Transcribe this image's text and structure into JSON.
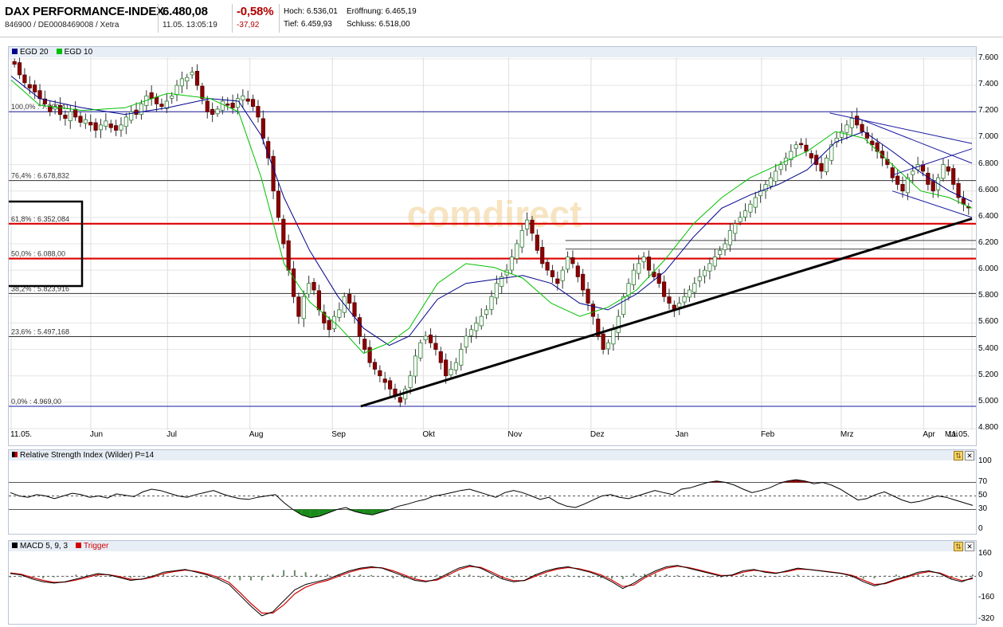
{
  "header": {
    "name": "DAX PERFORMANCE-INDEX",
    "ids": "846900 / DE0008469008 / Xetra",
    "price": "6.480,08",
    "time": "11.05. 13:05:19",
    "change_pct": "-0,58%",
    "change_abs": "-37,92",
    "hoch_label": "Hoch:",
    "hoch": "6.536,01",
    "tief_label": "Tief:",
    "tief": "6.459,93",
    "eroeffnung_label": "Eröffnung:",
    "eroeffnung": "6.465,19",
    "schluss_label": "Schluss:",
    "schluss": "6.518,00"
  },
  "watermark": "comdirect",
  "colors": {
    "candle_up": "#2e7d32",
    "candle_down": "#8b0000",
    "egd20": "#00008b",
    "egd10": "#00c000",
    "fib_support": "#dd0000",
    "trend": "#000000",
    "channel": "#1a1aa0",
    "macd": "#000000",
    "trigger": "#d00000"
  },
  "main_chart": {
    "legend": [
      {
        "label": "EGD 20",
        "color": "#00008b"
      },
      {
        "label": "EGD 10",
        "color": "#00c000"
      }
    ],
    "y_ticks": [
      "7.600",
      "7.400",
      "7.200",
      "7.000",
      "6.800",
      "6.600",
      "6.400",
      "6.200",
      "6.000",
      "5.800",
      "5.600",
      "5.400",
      "5.200",
      "5.000",
      "4.800"
    ],
    "x_labels": [
      "11.05.",
      "Jun",
      "Jul",
      "Aug",
      "Sep",
      "Okt",
      "Nov",
      "Dez",
      "Jan",
      "Feb",
      "Mrz",
      "Apr",
      "Mai",
      "11.05."
    ],
    "fib_levels": [
      {
        "label": "100,0% : 7.200,41",
        "value": 7200.41
      },
      {
        "label": "76,4% : 6.678,832",
        "value": 6678.832
      },
      {
        "label": "61,8% : 6.352,084",
        "value": 6352.084
      },
      {
        "label": "50,0% : 6.088,00",
        "value": 6088.0
      },
      {
        "label": "38,2% : 5.823,916",
        "value": 5823.916
      },
      {
        "label": "23,6% : 5.497,168",
        "value": 5497.168
      },
      {
        "label": "0,0% : 4.969,00",
        "value": 4969.0
      }
    ]
  },
  "chart_data": [
    {
      "type": "candlestick",
      "title": "DAX PERFORMANCE-INDEX",
      "x_range": [
        "11.05.",
        "11.05."
      ],
      "ylim": [
        4800,
        7600
      ],
      "grid": true,
      "legend_position": "top-left",
      "series": [
        {
          "name": "EGD 20",
          "type": "line",
          "points": [
            [
              0,
              7470
            ],
            [
              10,
              7300
            ],
            [
              25,
              7230
            ],
            [
              40,
              7180
            ],
            [
              55,
              7230
            ],
            [
              70,
              7300
            ],
            [
              80,
              7280
            ],
            [
              88,
              7020
            ],
            [
              96,
              6550
            ],
            [
              105,
              6150
            ],
            [
              115,
              5800
            ],
            [
              124,
              5560
            ],
            [
              133,
              5430
            ],
            [
              140,
              5500
            ],
            [
              150,
              5780
            ],
            [
              160,
              5900
            ],
            [
              170,
              5930
            ],
            [
              180,
              5960
            ],
            [
              190,
              5900
            ],
            [
              200,
              5750
            ],
            [
              210,
              5700
            ],
            [
              220,
              5820
            ],
            [
              230,
              5990
            ],
            [
              240,
              6250
            ],
            [
              250,
              6470
            ],
            [
              260,
              6570
            ],
            [
              270,
              6650
            ],
            [
              280,
              6760
            ],
            [
              290,
              6970
            ],
            [
              300,
              7050
            ],
            [
              310,
              6900
            ],
            [
              320,
              6740
            ],
            [
              330,
              6600
            ],
            [
              338,
              6520
            ]
          ]
        },
        {
          "name": "EGD 10",
          "type": "line",
          "points": [
            [
              0,
              7440
            ],
            [
              10,
              7250
            ],
            [
              25,
              7210
            ],
            [
              40,
              7230
            ],
            [
              55,
              7340
            ],
            [
              70,
              7300
            ],
            [
              80,
              7200
            ],
            [
              88,
              6700
            ],
            [
              96,
              6050
            ],
            [
              105,
              5760
            ],
            [
              115,
              5580
            ],
            [
              124,
              5370
            ],
            [
              133,
              5450
            ],
            [
              140,
              5560
            ],
            [
              150,
              5900
            ],
            [
              160,
              6050
            ],
            [
              170,
              6020
            ],
            [
              180,
              5940
            ],
            [
              190,
              5750
            ],
            [
              200,
              5650
            ],
            [
              210,
              5720
            ],
            [
              220,
              5850
            ],
            [
              230,
              6080
            ],
            [
              240,
              6350
            ],
            [
              250,
              6550
            ],
            [
              260,
              6700
            ],
            [
              270,
              6800
            ],
            [
              280,
              6900
            ],
            [
              290,
              7050
            ],
            [
              300,
              7000
            ],
            [
              310,
              6800
            ],
            [
              320,
              6600
            ],
            [
              330,
              6550
            ],
            [
              338,
              6470
            ]
          ]
        },
        {
          "name": "Trend",
          "type": "line",
          "points": [
            [
              123,
              4969
            ],
            [
              338,
              6390
            ]
          ]
        },
        {
          "name": "Channel upper",
          "type": "line",
          "points": [
            [
              288,
              7190
            ],
            [
              338,
              6960
            ]
          ]
        },
        {
          "name": "Channel mid",
          "type": "line",
          "points": [
            [
              298,
              7150
            ],
            [
              338,
              6810
            ]
          ]
        },
        {
          "name": "Channel low",
          "type": "line",
          "points": [
            [
              310,
              6600
            ],
            [
              338,
              6400
            ]
          ]
        },
        {
          "name": "Channel inner",
          "type": "line",
          "points": [
            [
              310,
              6720
            ],
            [
              338,
              6920
            ]
          ]
        }
      ],
      "candles_close": [
        7560,
        7480,
        7420,
        7380,
        7350,
        7300,
        7260,
        7200,
        7240,
        7180,
        7150,
        7200,
        7160,
        7120,
        7140,
        7100,
        7060,
        7100,
        7130,
        7080,
        7060,
        7100,
        7160,
        7200,
        7180,
        7260,
        7320,
        7300,
        7260,
        7240,
        7280,
        7320,
        7400,
        7450,
        7460,
        7500,
        7400,
        7300,
        7200,
        7180,
        7220,
        7280,
        7250,
        7230,
        7300,
        7320,
        7280,
        7240,
        7160,
        7000,
        6850,
        6600,
        6400,
        6200,
        6000,
        5800,
        5650,
        5800,
        5900,
        5850,
        5700,
        5600,
        5550,
        5650,
        5700,
        5800,
        5750,
        5650,
        5500,
        5400,
        5300,
        5250,
        5200,
        5150,
        5100,
        5050,
        5000,
        5100,
        5200,
        5350,
        5450,
        5500,
        5450,
        5400,
        5300,
        5200,
        5250,
        5300,
        5400,
        5500,
        5550,
        5600,
        5650,
        5700,
        5800,
        5900,
        5950,
        6000,
        6100,
        6200,
        6300,
        6380,
        6280,
        6150,
        6050,
        6000,
        5950,
        5900,
        6000,
        6100,
        6050,
        5950,
        5850,
        5750,
        5650,
        5500,
        5400,
        5450,
        5550,
        5650,
        5800,
        5900,
        6000,
        6050,
        6100,
        6000,
        5950,
        5900,
        5800,
        5750,
        5700,
        5750,
        5800,
        5850,
        5900,
        5950,
        6000,
        6050,
        6100,
        6150,
        6200,
        6300,
        6350,
        6400,
        6450,
        6500,
        6550,
        6600,
        6650,
        6700,
        6750,
        6800,
        6850,
        6900,
        6950,
        6950,
        6900,
        6850,
        6800,
        6750,
        6850,
        6950,
        7000,
        7050,
        7100,
        7150,
        7100,
        7050,
        7000,
        6950,
        6900,
        6850,
        6800,
        6700,
        6650,
        6600,
        6700,
        6750,
        6800,
        6750,
        6650,
        6600,
        6700,
        6800,
        6750,
        6650,
        6550,
        6500,
        6480
      ]
    },
    {
      "type": "line",
      "title": "Relative Strength Index (Wilder) P=14",
      "ylim": [
        0,
        100
      ],
      "y_ticks": [
        "100",
        "70",
        "50",
        "30",
        "0"
      ],
      "reference_lines": [
        70,
        50,
        30
      ],
      "series": [
        {
          "name": "RSI",
          "values": [
            55,
            50,
            48,
            52,
            50,
            46,
            50,
            54,
            52,
            48,
            50,
            47,
            53,
            51,
            49,
            56,
            60,
            58,
            54,
            50,
            48,
            52,
            55,
            58,
            53,
            49,
            46,
            45,
            48,
            50,
            52,
            40,
            30,
            22,
            18,
            20,
            25,
            30,
            33,
            27,
            24,
            22,
            26,
            30,
            35,
            38,
            42,
            45,
            50,
            52,
            55,
            58,
            60,
            56,
            52,
            48,
            55,
            58,
            55,
            50,
            45,
            48,
            40,
            35,
            33,
            38,
            44,
            50,
            52,
            48,
            46,
            50,
            54,
            58,
            55,
            52,
            60,
            62,
            66,
            70,
            72,
            70,
            66,
            60,
            55,
            58,
            62,
            68,
            72,
            74,
            72,
            68,
            70,
            66,
            60,
            52,
            44,
            46,
            52,
            56,
            50,
            44,
            40,
            42,
            46,
            50,
            48,
            44,
            40,
            36
          ]
        }
      ]
    },
    {
      "type": "line",
      "title": "MACD 5, 9, 3",
      "ylim": [
        -320,
        160
      ],
      "y_ticks": [
        "160",
        "0",
        "-160",
        "-320"
      ],
      "series": [
        {
          "name": "MACD 5, 9, 3",
          "values": [
            20,
            10,
            -20,
            -40,
            -50,
            -40,
            -20,
            0,
            20,
            10,
            -10,
            -30,
            -20,
            0,
            30,
            40,
            50,
            30,
            10,
            -20,
            -60,
            -140,
            -220,
            -290,
            -260,
            -180,
            -100,
            -60,
            -40,
            -20,
            10,
            40,
            60,
            70,
            60,
            30,
            0,
            -30,
            -40,
            -20,
            20,
            60,
            80,
            60,
            20,
            -20,
            -40,
            -30,
            10,
            40,
            60,
            70,
            50,
            30,
            0,
            -40,
            -90,
            -50,
            0,
            40,
            70,
            80,
            60,
            40,
            20,
            0,
            10,
            40,
            50,
            30,
            20,
            40,
            60,
            50,
            40,
            30,
            20,
            0,
            -40,
            -70,
            -50,
            -20,
            0,
            30,
            40,
            20,
            -20,
            -40,
            -10
          ]
        },
        {
          "name": "Trigger",
          "values": [
            25,
            15,
            -10,
            -30,
            -45,
            -42,
            -28,
            -8,
            12,
            12,
            -2,
            -22,
            -22,
            -6,
            20,
            35,
            46,
            36,
            18,
            -8,
            -45,
            -120,
            -200,
            -270,
            -270,
            -210,
            -130,
            -80,
            -50,
            -30,
            0,
            30,
            52,
            64,
            62,
            40,
            10,
            -20,
            -35,
            -28,
            8,
            48,
            72,
            66,
            32,
            -8,
            -32,
            -32,
            0,
            30,
            52,
            64,
            56,
            36,
            10,
            -28,
            -76,
            -64,
            -12,
            28,
            60,
            74,
            64,
            46,
            26,
            6,
            6,
            30,
            44,
            36,
            24,
            34,
            52,
            50,
            42,
            32,
            22,
            6,
            -28,
            -60,
            -54,
            -28,
            -6,
            20,
            34,
            24,
            -8,
            -32,
            -18
          ]
        }
      ]
    }
  ],
  "rsi_panel": {
    "title": "Relative Strength Index (Wilder) P=14",
    "y_ticks": [
      "100",
      "70",
      "50",
      "30",
      "0"
    ]
  },
  "macd_panel": {
    "macd_label": "MACD 5, 9, 3",
    "trigger_label": "Trigger",
    "y_ticks": [
      "160",
      "0",
      "-160",
      "-320"
    ]
  },
  "panel_buttons": {
    "config": "⇅",
    "close": "✕"
  }
}
